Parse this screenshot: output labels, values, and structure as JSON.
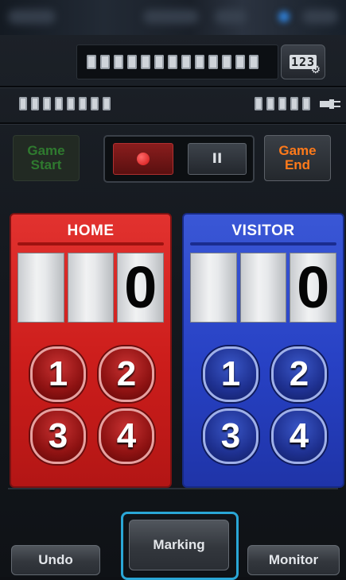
{
  "team_home": {
    "title": "HOME",
    "score_digits": [
      "",
      "",
      "0"
    ],
    "buttons": [
      "1",
      "2",
      "3",
      "4"
    ]
  },
  "team_visitor": {
    "title": "VISITOR",
    "score_digits": [
      "",
      "",
      "0"
    ],
    "buttons": [
      "1",
      "2",
      "3",
      "4"
    ]
  },
  "controls": {
    "game_start": [
      "Game",
      "Start"
    ],
    "game_end": [
      "Game",
      "End"
    ],
    "pause_label": "II"
  },
  "settings_button": {
    "label": "123"
  },
  "bottom": {
    "undo": "Undo",
    "marking": "Marking",
    "monitor": "Monitor"
  },
  "colors": {
    "home": "#cc1d1b",
    "visitor": "#2741c4",
    "game_end": "#ff7a1a",
    "highlight": "#2aa6d6"
  }
}
